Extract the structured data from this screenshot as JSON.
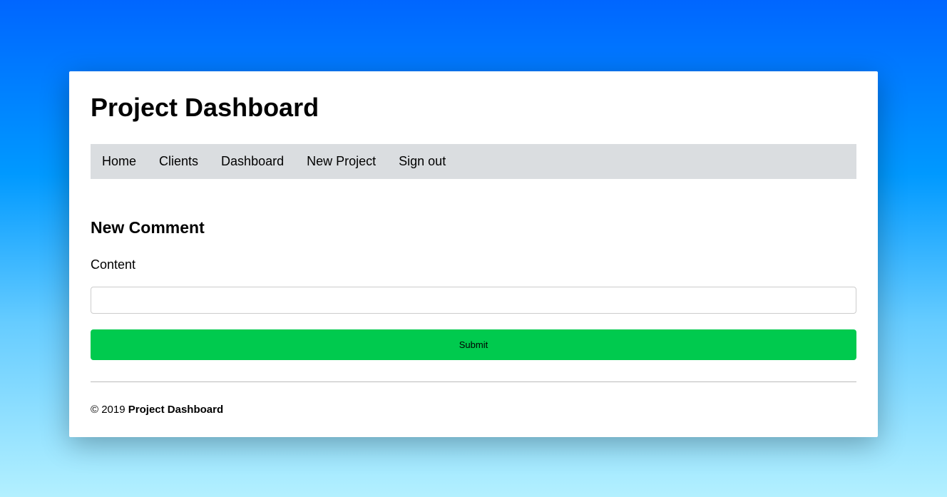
{
  "app": {
    "title": "Project Dashboard"
  },
  "nav": {
    "items": [
      {
        "label": "Home"
      },
      {
        "label": "Clients"
      },
      {
        "label": "Dashboard"
      },
      {
        "label": "New Project"
      },
      {
        "label": "Sign out"
      }
    ]
  },
  "form": {
    "heading": "New Comment",
    "content_label": "Content",
    "content_value": "",
    "submit_label": "Submit"
  },
  "footer": {
    "copyright_prefix": "© 2019 ",
    "brand": "Project Dashboard"
  }
}
